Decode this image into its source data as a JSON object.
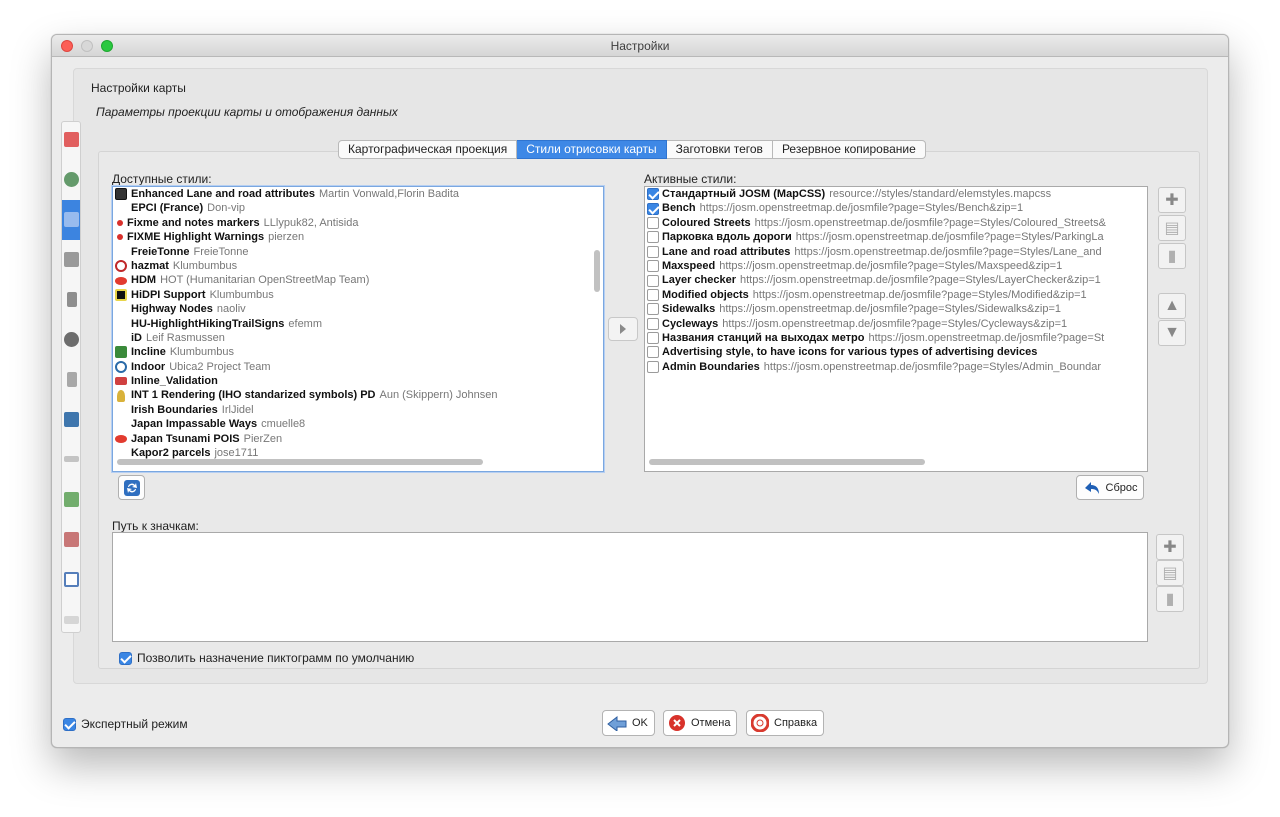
{
  "window": {
    "title": "Настройки"
  },
  "header": {
    "title": "Настройки карты",
    "subtitle": "Параметры проекции карты и отображения данных"
  },
  "tabs": [
    {
      "label": "Картографическая проекция",
      "active": false
    },
    {
      "label": "Стили отрисовки карты",
      "active": true
    },
    {
      "label": "Заготовки тегов",
      "active": false
    },
    {
      "label": "Резервное копирование",
      "active": false
    }
  ],
  "available": {
    "label": "Доступные стили:",
    "items": [
      {
        "name": "Enhanced Lane and road attributes",
        "author": "Martin Vonwald,Florin Badita",
        "icon": "lane-icon"
      },
      {
        "name": "EPCI (France)",
        "author": "Don-vip",
        "icon": ""
      },
      {
        "name": "Fixme and notes markers",
        "author": "LLlypuk82, Antisida",
        "icon": "red-dot-icon"
      },
      {
        "name": "FIXME Highlight Warnings",
        "author": "pierzen",
        "icon": "red-dot-icon"
      },
      {
        "name": "FreieTonne",
        "author": "FreieTonne",
        "icon": ""
      },
      {
        "name": "hazmat",
        "author": "Klumbumbus",
        "icon": "hazmat-icon"
      },
      {
        "name": "HDM",
        "author": "HOT (Humanitarian OpenStreetMap Team)",
        "icon": "eye-icon"
      },
      {
        "name": "HiDPI Support",
        "author": "Klumbumbus",
        "icon": "hidpi-icon"
      },
      {
        "name": "Highway Nodes",
        "author": "naoliv",
        "icon": ""
      },
      {
        "name": "HU-HighlightHikingTrailSigns",
        "author": "efemm",
        "icon": ""
      },
      {
        "name": "iD",
        "author": "Leif Rasmussen",
        "icon": ""
      },
      {
        "name": "Incline",
        "author": "Klumbumbus",
        "icon": "incline-icon"
      },
      {
        "name": "Indoor",
        "author": "Ubica2 Project Team",
        "icon": "indoor-icon"
      },
      {
        "name": "Inline_Validation",
        "author": "",
        "icon": "validation-icon"
      },
      {
        "name": "INT 1 Rendering (IHO standarized symbols) PD",
        "author": "Aun (Skippern) Johnsen",
        "icon": "buoy-icon"
      },
      {
        "name": "Irish Boundaries",
        "author": "IrlJidel",
        "icon": ""
      },
      {
        "name": "Japan Impassable Ways",
        "author": "cmuelle8",
        "icon": ""
      },
      {
        "name": "Japan Tsunami POIS",
        "author": "PierZen",
        "icon": "eye-icon"
      },
      {
        "name": "Kapor2 parcels",
        "author": "jose1711",
        "icon": ""
      }
    ]
  },
  "active": {
    "label": "Активные стили:",
    "items": [
      {
        "name": "Стандартный JOSM (MapCSS)",
        "url": "resource://styles/standard/elemstyles.mapcss",
        "checked": true
      },
      {
        "name": "Bench",
        "url": "https://josm.openstreetmap.de/josmfile?page=Styles/Bench&zip=1",
        "checked": true
      },
      {
        "name": "Coloured Streets",
        "url": "https://josm.openstreetmap.de/josmfile?page=Styles/Coloured_Streets&",
        "checked": false
      },
      {
        "name": "Парковка вдоль дороги",
        "url": "https://josm.openstreetmap.de/josmfile?page=Styles/ParkingLa",
        "checked": false
      },
      {
        "name": "Lane and road attributes",
        "url": "https://josm.openstreetmap.de/josmfile?page=Styles/Lane_and",
        "checked": false
      },
      {
        "name": "Maxspeed",
        "url": "https://josm.openstreetmap.de/josmfile?page=Styles/Maxspeed&zip=1",
        "checked": false
      },
      {
        "name": "Layer checker",
        "url": "https://josm.openstreetmap.de/josmfile?page=Styles/LayerChecker&zip=1",
        "checked": false
      },
      {
        "name": "Modified objects",
        "url": "https://josm.openstreetmap.de/josmfile?page=Styles/Modified&zip=1",
        "checked": false
      },
      {
        "name": "Sidewalks",
        "url": "https://josm.openstreetmap.de/josmfile?page=Styles/Sidewalks&zip=1",
        "checked": false
      },
      {
        "name": "Cycleways",
        "url": "https://josm.openstreetmap.de/josmfile?page=Styles/Cycleways&zip=1",
        "checked": false
      },
      {
        "name": "Названия станций на выходах метро",
        "url": "https://josm.openstreetmap.de/josmfile?page=St",
        "checked": false
      },
      {
        "name": "Advertising style, to have icons for various types of advertising devices",
        "url": "",
        "checked": false
      },
      {
        "name": "Admin Boundaries",
        "url": "https://josm.openstreetmap.de/josmfile?page=Styles/Admin_Boundar",
        "checked": false
      }
    ]
  },
  "reset_label": "Сброс",
  "icon_path_label": "Путь к значкам:",
  "allow_default_icons": {
    "label": "Позволить назначение пиктограмм по умолчанию",
    "checked": true
  },
  "expert_mode": {
    "label": "Экспертный режим",
    "checked": true
  },
  "buttons": {
    "ok": "OK",
    "cancel": "Отмена",
    "help": "Справка"
  },
  "colors": {
    "accent": "#3e88e6"
  }
}
